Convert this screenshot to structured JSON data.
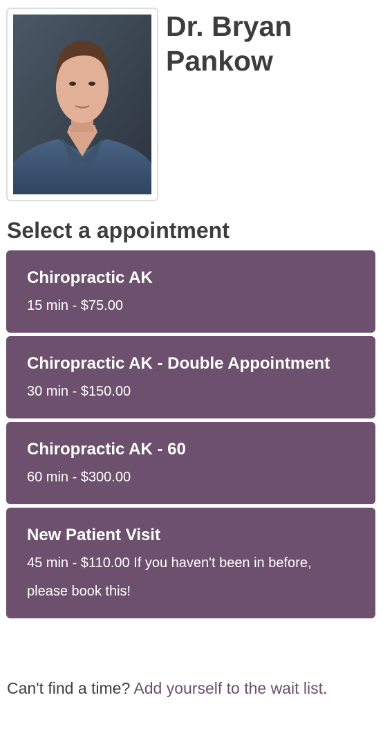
{
  "doctor": {
    "name": "Dr. Bryan Pankow",
    "photo_alt": "Dr. Bryan Pankow"
  },
  "section_title": "Select a appointment",
  "appointments": [
    {
      "title": "Chiropractic AK",
      "detail": "15 min - $75.00"
    },
    {
      "title": "Chiropractic AK - Double Appointment",
      "detail": "30 min - $150.00"
    },
    {
      "title": "Chiropractic AK - 60",
      "detail": "60 min - $300.00"
    },
    {
      "title": "New Patient Visit",
      "detail": "45 min - $110.00 If you haven't been in before, please book this!"
    }
  ],
  "waitlist": {
    "prompt": "Can't find a time? ",
    "link_label": "Add yourself to the wait list",
    "trailing": "."
  }
}
